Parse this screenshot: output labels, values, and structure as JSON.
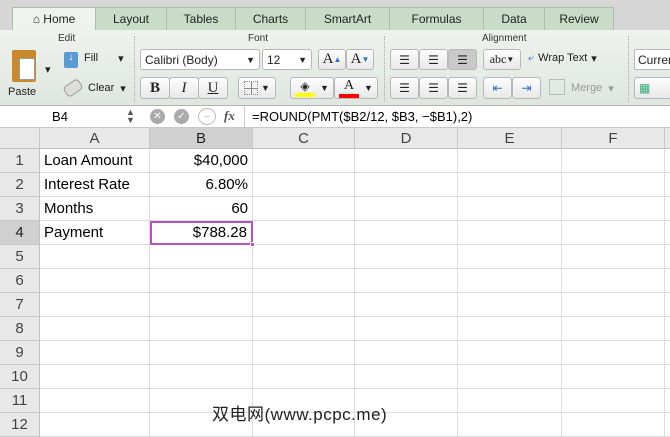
{
  "tabs": [
    "Home",
    "Layout",
    "Tables",
    "Charts",
    "SmartArt",
    "Formulas",
    "Data",
    "Review"
  ],
  "ribbon": {
    "edit": {
      "title": "Edit",
      "paste": "Paste",
      "fill": "Fill",
      "clear": "Clear"
    },
    "font": {
      "title": "Font",
      "font_name": "Calibri (Body)",
      "font_size": "12",
      "bold": "B",
      "italic": "I",
      "underline": "U",
      "grow": "A",
      "shrink": "A",
      "font_color": "A",
      "fill_color_hex": "#ffff00",
      "font_color_hex": "#ff0000"
    },
    "alignment": {
      "title": "Alignment",
      "orientation": "abc",
      "wrap_text": "Wrap Text",
      "merge": "Merge"
    },
    "number": {
      "format": "Curren"
    }
  },
  "formula_bar": {
    "cell_ref": "B4",
    "fx": "fx",
    "formula": "=ROUND(PMT($B2/12, $B3, −$B1),2)"
  },
  "columns": [
    "A",
    "B",
    "C",
    "D",
    "E",
    "F"
  ],
  "rows": [
    "1",
    "2",
    "3",
    "4",
    "5",
    "6",
    "7",
    "8",
    "9",
    "10",
    "11",
    "12"
  ],
  "cells": [
    {
      "a": "Loan Amount",
      "b": "$40,000"
    },
    {
      "a": "Interest Rate",
      "b": "6.80%"
    },
    {
      "a": "Months",
      "b": "60"
    },
    {
      "a": "Payment",
      "b": "$788.28"
    }
  ],
  "selected_accent": "#b94fc8",
  "watermark": "双电网(www.pcpc.me)"
}
